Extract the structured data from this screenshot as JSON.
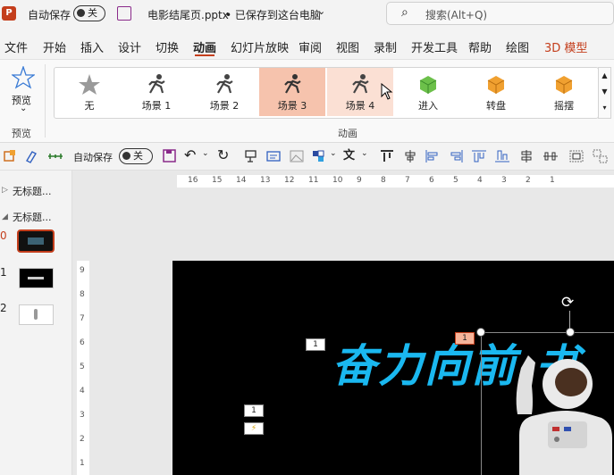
{
  "titlebar": {
    "autosave_label": "自动保存",
    "toggle_state": "关",
    "document_name": "电影结尾页.pptx",
    "save_status": "• 已保存到这台电脑",
    "search_placeholder": "搜索(Alt+Q)"
  },
  "menu": {
    "items": [
      "文件",
      "开始",
      "插入",
      "设计",
      "切换",
      "动画",
      "幻灯片放映",
      "审阅",
      "视图",
      "录制",
      "开发工具",
      "帮助",
      "绘图",
      "3D 模型"
    ],
    "active": "动画"
  },
  "ribbon": {
    "preview_label": "预览",
    "preview_group_label": "预览",
    "animation_group_label": "动画",
    "gallery": [
      "无",
      "场景 1",
      "场景 2",
      "场景 3",
      "场景 4",
      "进入",
      "转盘",
      "摇摆"
    ]
  },
  "qat": {
    "autosave_label": "自动保存",
    "toggle_state": "关"
  },
  "left_panel": {
    "sections": [
      "无标题...",
      "无标题..."
    ],
    "slide_numbers": [
      "0",
      "1",
      "2"
    ]
  },
  "ruler": {
    "h_labels": [
      "16",
      "15",
      "14",
      "13",
      "12",
      "11",
      "10",
      "9",
      "8",
      "7",
      "6",
      "5",
      "4",
      "3",
      "2",
      "1"
    ],
    "v_labels": [
      "9",
      "8",
      "7",
      "6",
      "5",
      "4",
      "3",
      "2",
      "1"
    ]
  },
  "slide": {
    "title_text": "奋力向前 书",
    "tag_title": "1",
    "tag_selected": "1",
    "tag_left": "1"
  },
  "colors": {
    "accent": "#c43e1c",
    "title_blue": "#1ab8f0",
    "selected_scene": "#f6c3ad",
    "hover_scene": "#fbe0d4"
  }
}
